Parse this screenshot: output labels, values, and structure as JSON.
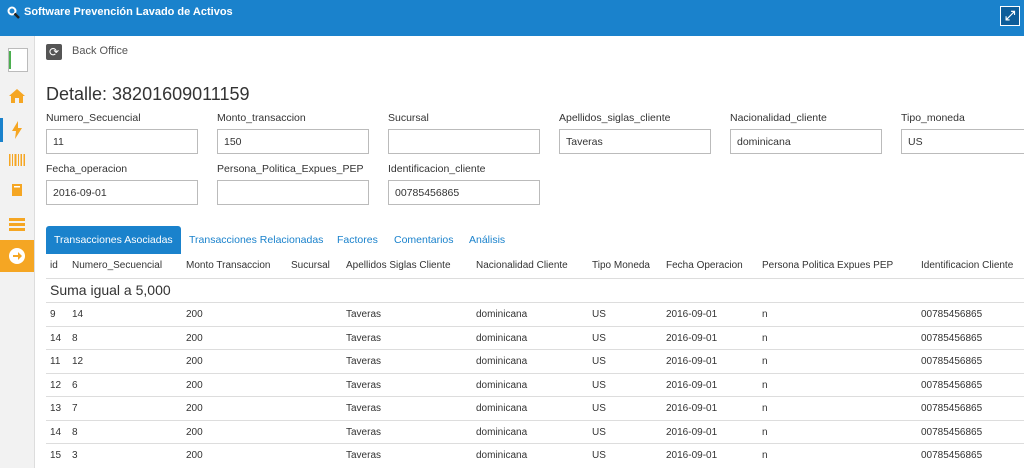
{
  "window": {
    "title": "Software Prevención Lavado de Activos"
  },
  "header": {
    "breadcrumb": "Back Office",
    "detail_title": "Detalle: 38201609011159"
  },
  "form": {
    "numero_secuencial": {
      "label": "Numero_Secuencial",
      "value": "11"
    },
    "monto_transaccion": {
      "label": "Monto_transaccion",
      "value": "150"
    },
    "sucursal": {
      "label": "Sucursal",
      "value": ""
    },
    "apellidos": {
      "label": "Apellidos_siglas_cliente",
      "value": "Taveras"
    },
    "nacionalidad": {
      "label": "Nacionalidad_cliente",
      "value": "dominicana"
    },
    "tipo_moneda": {
      "label": "Tipo_moneda",
      "value": "US"
    },
    "fecha_operacion": {
      "label": "Fecha_operacion",
      "value": "2016-09-01"
    },
    "persona_politica": {
      "label": "Persona_Politica_Expues_PEP",
      "value": ""
    },
    "identificacion": {
      "label": "Identificacion_cliente",
      "value": "00785456865"
    }
  },
  "tabs": [
    "Transacciones Asociadas",
    "Transacciones Relacionadas",
    "Factores",
    "Comentarios",
    "Análisis"
  ],
  "table": {
    "columns": [
      "id",
      "Numero_Secuencial",
      "Monto Transaccion",
      "Sucursal",
      "Apellidos Siglas Cliente",
      "Nacionalidad Cliente",
      "Tipo Moneda",
      "Fecha Operacion",
      "Persona Politica Expues PEP",
      "Identificacion Cliente"
    ],
    "group_label": "Suma igual a 5,000",
    "rows": [
      [
        "9",
        "14",
        "200",
        "",
        "Taveras",
        "dominicana",
        "US",
        "2016-09-01",
        "n",
        "00785456865"
      ],
      [
        "14",
        "8",
        "200",
        "",
        "Taveras",
        "dominicana",
        "US",
        "2016-09-01",
        "n",
        "00785456865"
      ],
      [
        "11",
        "12",
        "200",
        "",
        "Taveras",
        "dominicana",
        "US",
        "2016-09-01",
        "n",
        "00785456865"
      ],
      [
        "12",
        "6",
        "200",
        "",
        "Taveras",
        "dominicana",
        "US",
        "2016-09-01",
        "n",
        "00785456865"
      ],
      [
        "13",
        "7",
        "200",
        "",
        "Taveras",
        "dominicana",
        "US",
        "2016-09-01",
        "n",
        "00785456865"
      ],
      [
        "14",
        "8",
        "200",
        "",
        "Taveras",
        "dominicana",
        "US",
        "2016-09-01",
        "n",
        "00785456865"
      ],
      [
        "15",
        "3",
        "200",
        "",
        "Taveras",
        "dominicana",
        "US",
        "2016-09-01",
        "n",
        "00785456865"
      ]
    ]
  },
  "sidebar": {
    "icons": [
      "user-avatar-icon",
      "home-icon",
      "lightning-icon",
      "barcode-icon",
      "book-icon",
      "list-icon",
      "arrow-right-icon"
    ]
  },
  "colors": {
    "accent": "#1a82cc",
    "active_nav": "#f5a623"
  }
}
